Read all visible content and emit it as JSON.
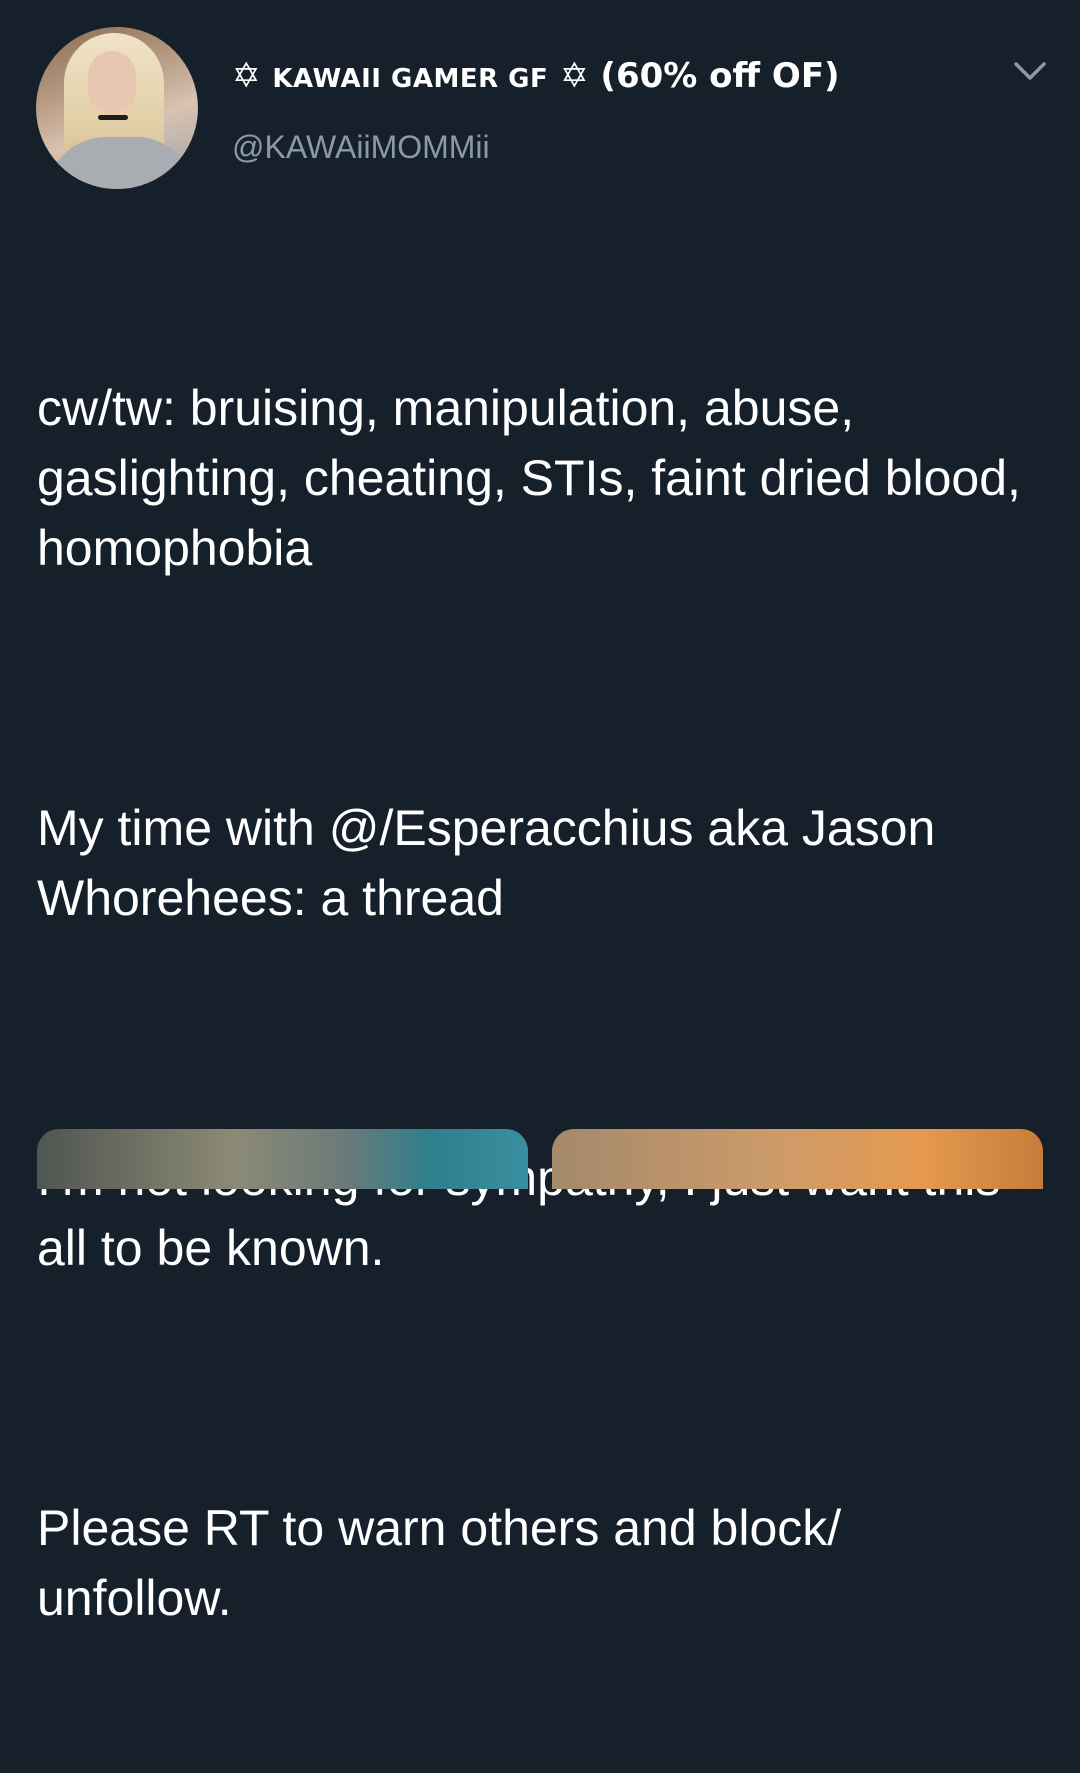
{
  "tweet": {
    "author": {
      "display_name_prefix": "✡",
      "display_name_caps": "KAWAII GAMER GF",
      "display_name_suffix": "✡ (60% off OF)",
      "handle": "@KAWAiiMOMMii"
    },
    "paragraphs": [
      "cw/tw: bruising, manipulation, abuse, gaslighting, cheating, STIs, faint dried blood, homophobia",
      "My time with @/Esperacchius aka Jason Whorehees: a thread",
      "I’m not looking for sympathy, I just want this all to be known.",
      "Please RT to warn others and block/ unfollow."
    ],
    "menu_icon": "chevron-down-icon"
  },
  "colors": {
    "background": "#16202b",
    "text": "#ffffff",
    "secondary_text": "#8b98a5"
  }
}
